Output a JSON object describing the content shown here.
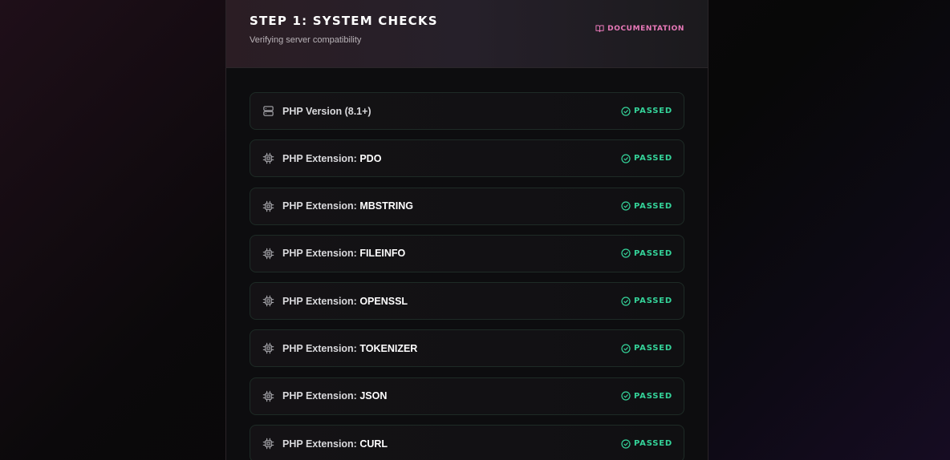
{
  "header": {
    "title": "STEP 1: SYSTEM CHECKS",
    "subtitle": "Verifying server compatibility",
    "doc_link_label": "DOCUMENTATION",
    "doc_icon": "book-open-icon"
  },
  "colors": {
    "accent_pink": "#e879b9",
    "passed_green": "#34d399"
  },
  "checks": [
    {
      "prefix": "PHP Version (8.1+)",
      "name": "",
      "status": "PASSED",
      "icon": "server-icon"
    },
    {
      "prefix": "PHP Extension: ",
      "name": "PDO",
      "status": "PASSED",
      "icon": "cpu-chip-icon"
    },
    {
      "prefix": "PHP Extension: ",
      "name": "MBSTRING",
      "status": "PASSED",
      "icon": "cpu-chip-icon"
    },
    {
      "prefix": "PHP Extension: ",
      "name": "FILEINFO",
      "status": "PASSED",
      "icon": "cpu-chip-icon"
    },
    {
      "prefix": "PHP Extension: ",
      "name": "OPENSSL",
      "status": "PASSED",
      "icon": "cpu-chip-icon"
    },
    {
      "prefix": "PHP Extension: ",
      "name": "TOKENIZER",
      "status": "PASSED",
      "icon": "cpu-chip-icon"
    },
    {
      "prefix": "PHP Extension: ",
      "name": "JSON",
      "status": "PASSED",
      "icon": "cpu-chip-icon"
    },
    {
      "prefix": "PHP Extension: ",
      "name": "CURL",
      "status": "PASSED",
      "icon": "cpu-chip-icon"
    }
  ]
}
